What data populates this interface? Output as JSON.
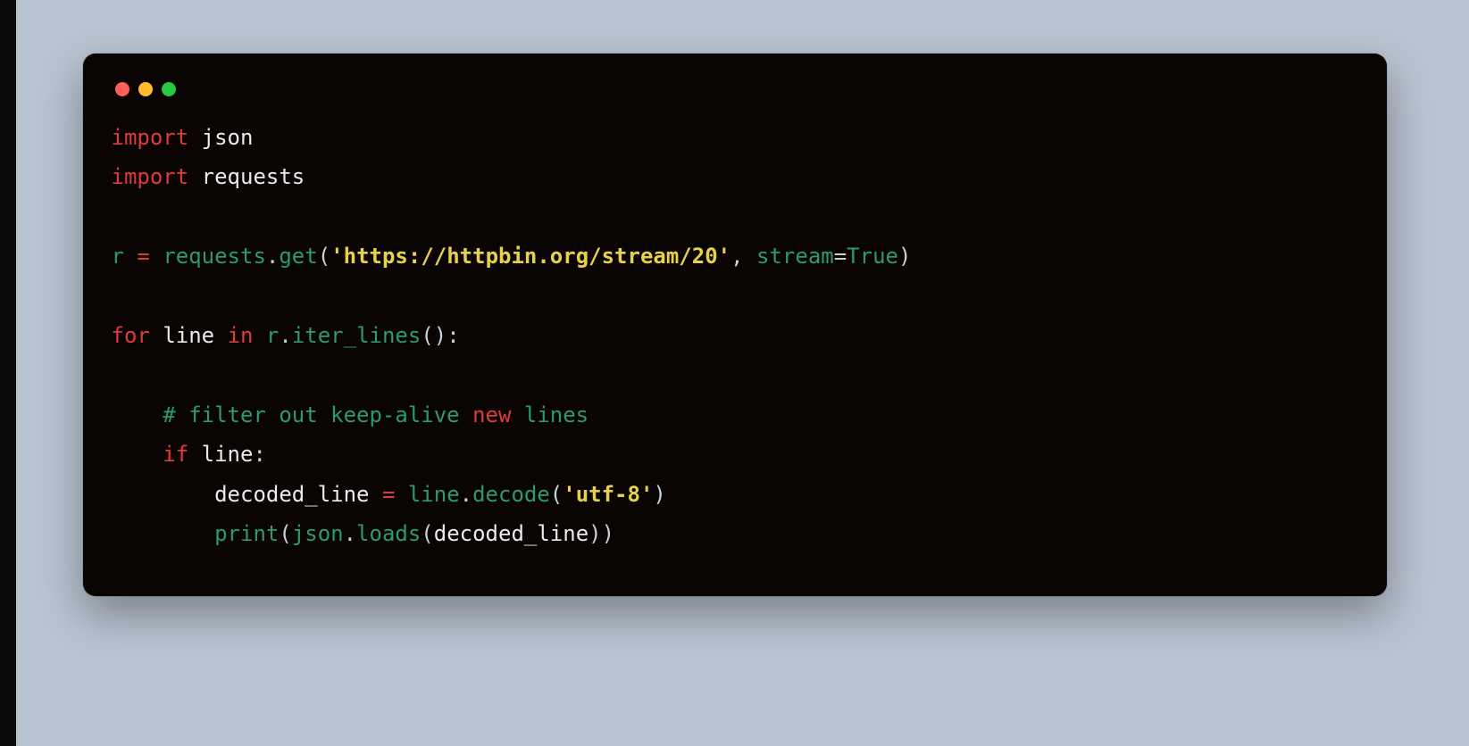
{
  "titlebar": {
    "dots": [
      "red",
      "yellow",
      "green"
    ]
  },
  "code": {
    "import1_kw": "import",
    "import1_mod": "json",
    "import2_kw": "import",
    "import2_mod": "requests",
    "assign_var": "r",
    "assign_op": "=",
    "assign_mod": "requests",
    "assign_fn": "get",
    "assign_str": "'https://httpbin.org/stream/20'",
    "assign_comma": ",",
    "assign_kwarg": "stream",
    "assign_kweq": "=",
    "assign_true": "True",
    "for_kw": "for",
    "for_var": "line",
    "in_kw": "in",
    "for_src": "r",
    "for_fn": "iter_lines",
    "comment_prefix": "# filter out keep-alive ",
    "comment_new": "new",
    "comment_suffix": " lines",
    "if_kw": "if",
    "if_var": "line",
    "dec_lhs": "decoded_line",
    "dec_op": "=",
    "dec_src": "line",
    "dec_fn": "decode",
    "dec_str": "'utf-8'",
    "print_fn": "print",
    "print_mod": "json",
    "print_loads": "loads",
    "print_arg": "decoded_line"
  }
}
